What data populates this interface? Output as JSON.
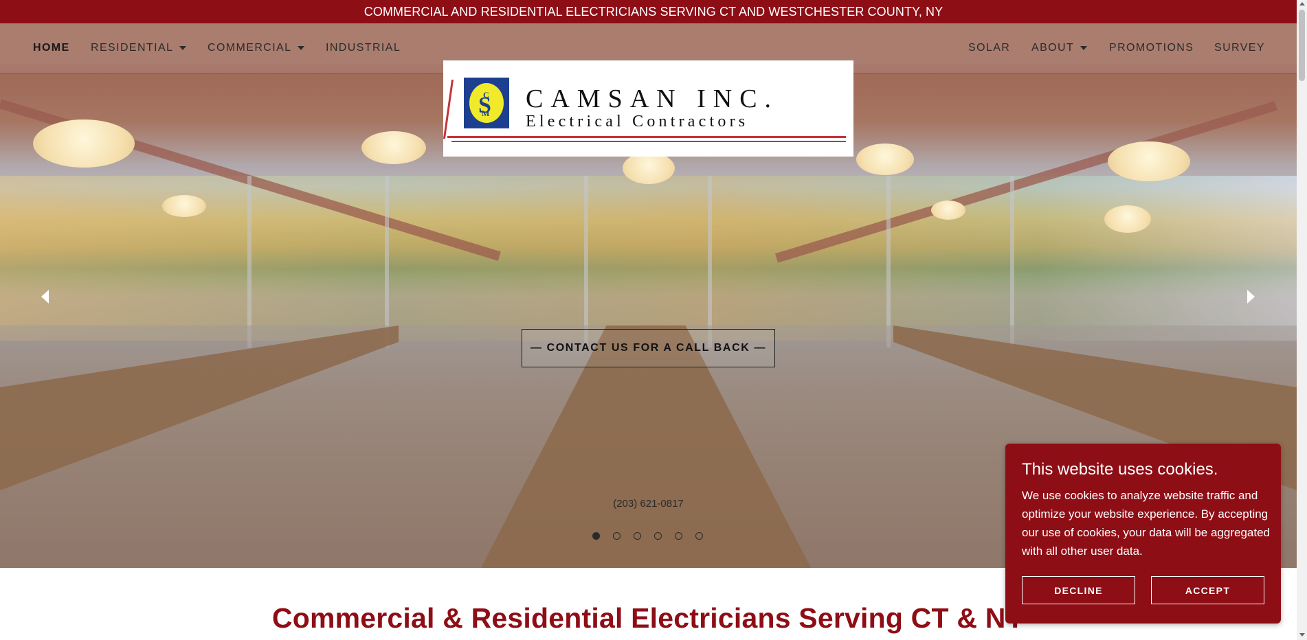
{
  "announcement": "COMMERCIAL AND RESIDENTIAL ELECTRICIANS SERVING CT AND WESTCHESTER COUNTY, NY",
  "nav": {
    "left": [
      {
        "label": "HOME",
        "active": true
      },
      {
        "label": "RESIDENTIAL",
        "dropdown": true
      },
      {
        "label": "COMMERCIAL",
        "dropdown": true
      },
      {
        "label": "INDUSTRIAL"
      }
    ],
    "right": [
      {
        "label": "SOLAR"
      },
      {
        "label": "ABOUT",
        "dropdown": true
      },
      {
        "label": "PROMOTIONS"
      },
      {
        "label": "SURVEY"
      }
    ]
  },
  "logo": {
    "name": "CAMSAN INC.",
    "tagline": "Electrical Contractors",
    "mark_letters": [
      "C",
      "S",
      "M"
    ],
    "colors": {
      "mark_bg": "#1d3f8f",
      "mark_fg": "#f0ea2a",
      "rule": "#c4333a"
    }
  },
  "hero": {
    "cta_label": "— CONTACT US FOR A CALL BACK —",
    "phone": "(203) 621-0817",
    "slides_total": 6,
    "active_slide": 1
  },
  "headline": "Commercial & Residential Electricians Serving CT & NY",
  "cookie": {
    "title": "This website uses cookies.",
    "body": "We use cookies to analyze website traffic and optimize your website experience. By accepting our use of cookies, your data will be aggregated with all other user data.",
    "decline_label": "DECLINE",
    "accept_label": "ACCEPT"
  },
  "colors": {
    "brand": "#8e0e16",
    "text_dark": "#2b2b2b"
  }
}
